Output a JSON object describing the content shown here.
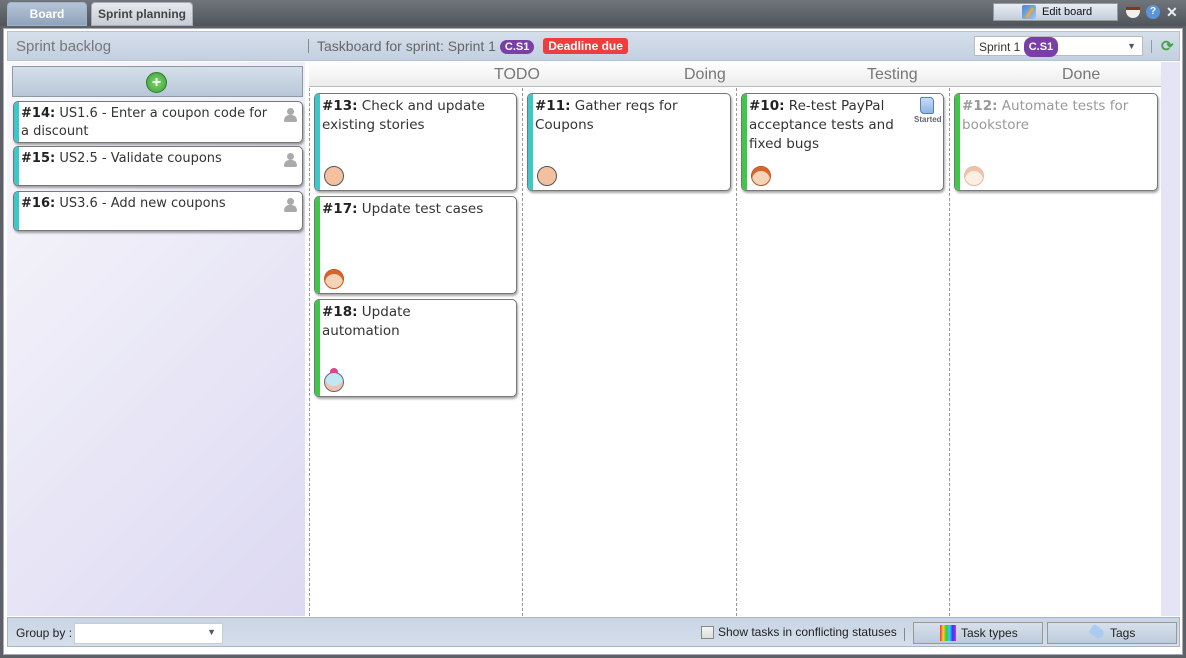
{
  "tabs": [
    {
      "label": "Board",
      "active": true
    },
    {
      "label": "Sprint planning",
      "active": false
    }
  ],
  "toolbar": {
    "edit_board": "Edit board",
    "icons": [
      "coffee-icon",
      "help-icon",
      "close-icon"
    ],
    "help_glyph": "?",
    "close_glyph": "✕"
  },
  "header": {
    "backlog_title": "Sprint backlog",
    "taskboard_title": "Taskboard for sprint: Sprint 1",
    "sprint_badge": "C.S1",
    "deadline_badge": "Deadline due",
    "sprint_select": {
      "value": "Sprint 1",
      "badge": "C.S1"
    }
  },
  "backlog": [
    {
      "id": "#14:",
      "title": "US1.6 - Enter a coupon code for a discount",
      "color": "#3cc8c8"
    },
    {
      "id": "#15:",
      "title": "US2.5 - Validate coupons",
      "color": "#3cc8c8"
    },
    {
      "id": "#16:",
      "title": "US3.6 - Add new coupons",
      "color": "#3cc8c8"
    }
  ],
  "columns": [
    "TODO",
    "Doing",
    "Testing",
    "Done"
  ],
  "tasks": {
    "todo": [
      {
        "id": "#13:",
        "title": "Check and update existing stories",
        "color": "#3cc8c8",
        "avatar": "bald-man"
      },
      {
        "id": "#17:",
        "title": "Update test cases",
        "color": "#3ec84a",
        "avatar": "redhead"
      },
      {
        "id": "#18:",
        "title": "Update automation",
        "color": "#3ec84a",
        "avatar": "pink-hair-glasses"
      }
    ],
    "doing": [
      {
        "id": "#11:",
        "title": "Gather reqs for Coupons",
        "color": "#3cc8c8",
        "avatar": "bald-man"
      }
    ],
    "testing": [
      {
        "id": "#10:",
        "title": "Re-test PayPal acceptance tests and fixed bugs",
        "color": "#3ec84a",
        "avatar": "redhead",
        "status": "Started"
      }
    ],
    "done": [
      {
        "id": "#12:",
        "title": "Automate tests for bookstore",
        "color": "#3ec84a",
        "avatar": "redhead"
      }
    ]
  },
  "footer": {
    "group_by_label": "Group by :",
    "group_by_value": "",
    "conflict_label": "Show tasks in conflicting statuses",
    "conflict_checked": false,
    "task_types": "Task types",
    "tags": "Tags"
  }
}
